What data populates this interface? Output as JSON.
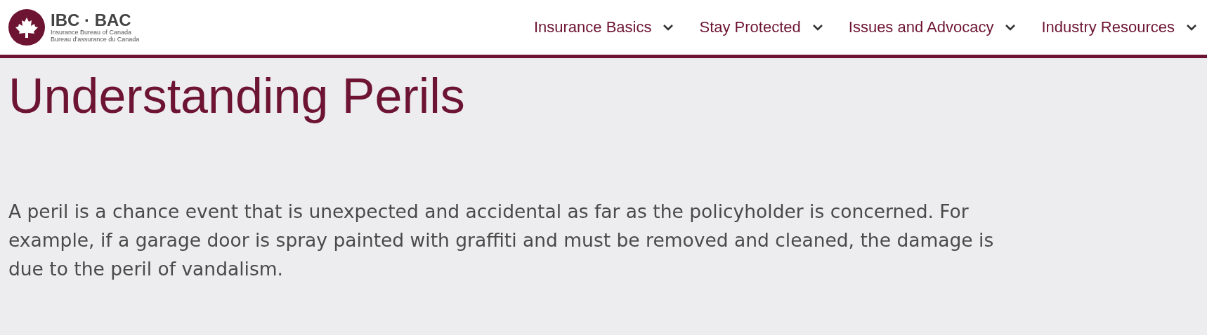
{
  "logo": {
    "name": "IBC · BAC",
    "tagline_en": "Insurance Bureau of Canada",
    "tagline_fr": "Bureau d'assurance du Canada"
  },
  "nav": [
    {
      "label": "Insurance Basics"
    },
    {
      "label": "Stay Protected"
    },
    {
      "label": "Issues and Advocacy"
    },
    {
      "label": "Industry Resources"
    }
  ],
  "title": "Understanding Perils",
  "paragraph": "A peril is a chance event that is unexpected and accidental as far as the policyholder is concerned. For example, if a garage door is spray painted with graffiti and must be removed and cleaned, the damage is due to the peril of vandalism."
}
